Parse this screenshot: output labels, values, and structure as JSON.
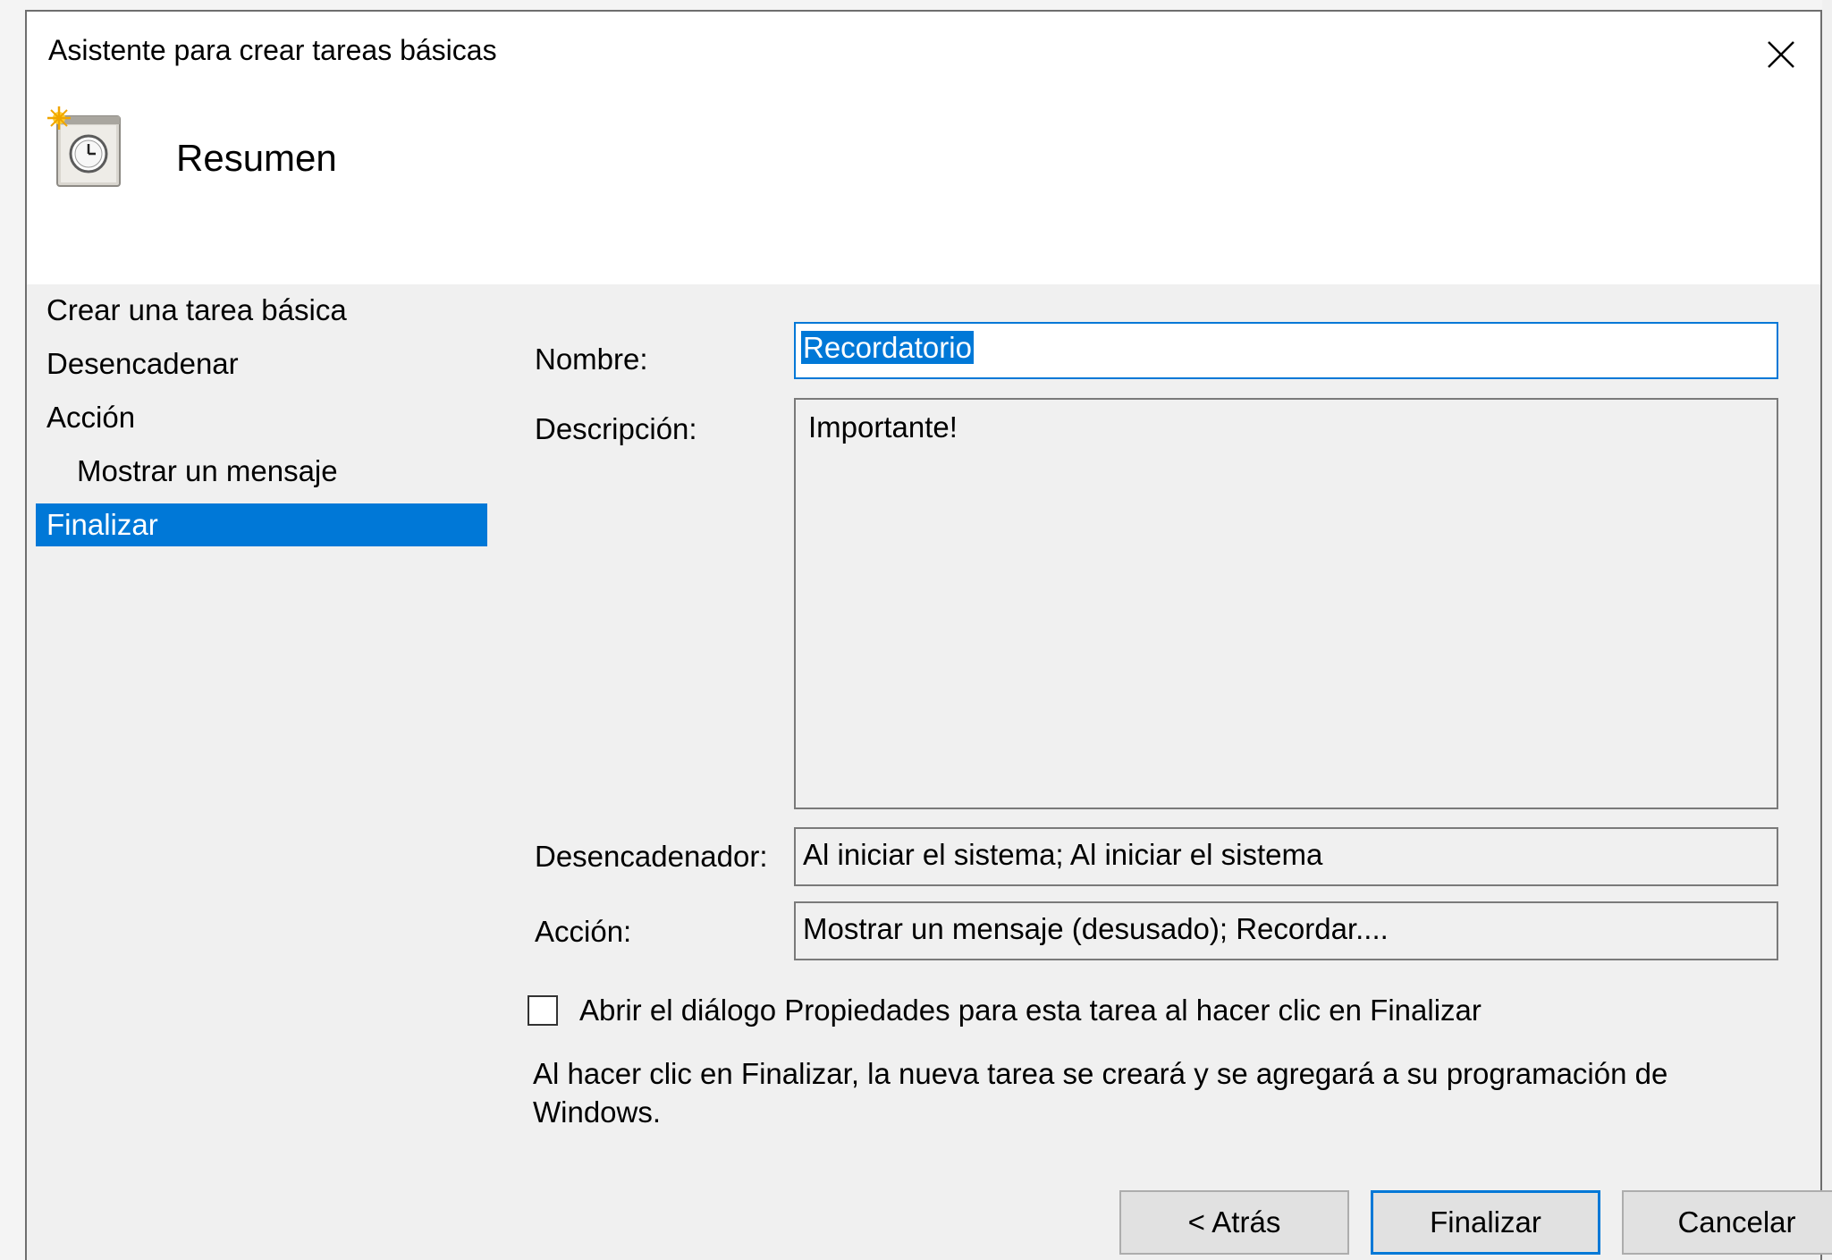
{
  "window": {
    "title": "Asistente para crear tareas básicas",
    "close_icon": "close-icon"
  },
  "header": {
    "icon": "scheduled-task-icon",
    "heading": "Resumen"
  },
  "steps": [
    {
      "label": "Crear una tarea básica",
      "active": false
    },
    {
      "label": "Desencadenar",
      "active": false
    },
    {
      "label": "Acción",
      "active": false
    },
    {
      "label": "Mostrar un mensaje",
      "active": false
    },
    {
      "label": "Finalizar",
      "active": true
    }
  ],
  "summary": {
    "name_label": "Nombre:",
    "name_value": "Recordatorio",
    "description_label": "Descripción:",
    "description_value": "Importante!",
    "trigger_label": "Desencadenador:",
    "trigger_value": "Al iniciar el sistema; Al iniciar el sistema",
    "action_label": "Acción:",
    "action_value": "Mostrar un mensaje (desusado); Recordar...."
  },
  "options": {
    "open_properties_label": "Abrir el diálogo Propiedades para esta tarea al hacer clic en Finalizar",
    "open_properties_checked": false,
    "note": "Al hacer clic en Finalizar, la nueva tarea se creará y se agregará a su programación de Windows."
  },
  "buttons": {
    "back": "< Atrás",
    "finish": "Finalizar",
    "cancel": "Cancelar"
  },
  "colors": {
    "accent": "#0078d7",
    "dialog_bg": "#f0f0f0"
  }
}
